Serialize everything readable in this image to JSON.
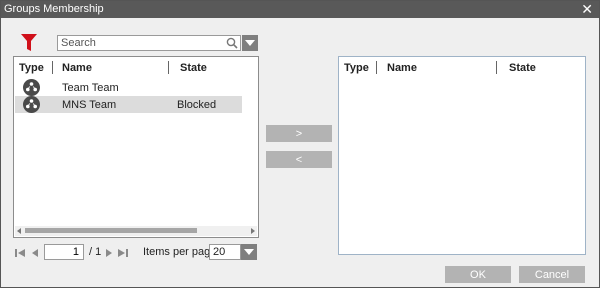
{
  "window": {
    "title": "Groups Membership",
    "close_glyph": "✕"
  },
  "search": {
    "placeholder": "Search"
  },
  "left_table": {
    "headers": {
      "type": "Type",
      "name": "Name",
      "state": "State"
    },
    "rows": [
      {
        "icon": "team-icon",
        "name": "Team Team",
        "state": "",
        "selected": false
      },
      {
        "icon": "team-icon",
        "name": "MNS Team",
        "state": "Blocked",
        "selected": true
      }
    ]
  },
  "right_table": {
    "headers": {
      "type": "Type",
      "name": "Name",
      "state": "State"
    }
  },
  "transfer": {
    "add_label": ">",
    "remove_label": "<"
  },
  "pager": {
    "page": "1",
    "total": "/ 1",
    "items_per_page_label": "Items per page:",
    "items_per_page": "20"
  },
  "footer": {
    "ok_label": "OK",
    "cancel_label": "Cancel"
  },
  "colors": {
    "titlebar": "#595959",
    "filter_icon": "#d0101a",
    "button_bg": "#b3b3b3"
  }
}
